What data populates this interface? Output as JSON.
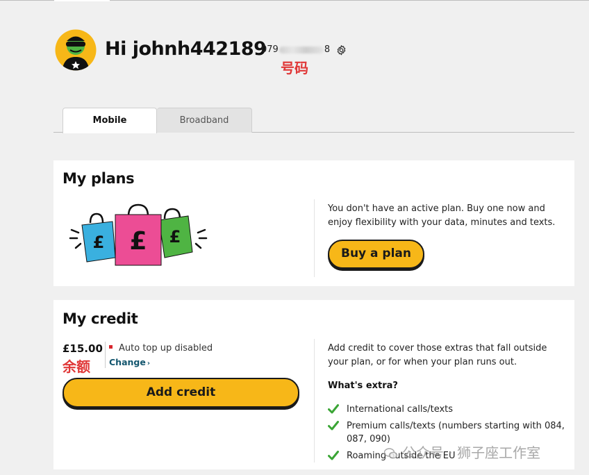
{
  "header": {
    "greeting": "Hi johnh442189",
    "phone_prefix": "079",
    "phone_suffix": "8",
    "phone_annotation": "号码"
  },
  "tabs": [
    {
      "label": "Mobile",
      "active": true
    },
    {
      "label": "Broadband",
      "active": false
    }
  ],
  "plans": {
    "title": "My plans",
    "message": "You don't have an active plan. Buy one now and enjoy flexibility with your data, minutes and texts.",
    "buy_button": "Buy a plan"
  },
  "credit": {
    "title": "My credit",
    "amount": "£15.00",
    "amount_annotation": "余额",
    "auto_topup_status": "Auto top up disabled",
    "change_link": "Change",
    "add_button": "Add credit",
    "message": "Add credit to cover those extras that fall outside your plan, or for when your plan runs out.",
    "extras_heading": "What's extra?",
    "extras": [
      "International calls/texts",
      "Premium calls/texts (numbers starting with 084, 087, 090)",
      "Roaming outside the EU"
    ]
  },
  "watermark": "公众号 · 狮子座工作室",
  "colors": {
    "accent_yellow": "#f7b718",
    "link_teal": "#13566e",
    "status_red": "#d8262d",
    "check_green": "#3aa535",
    "annotation_red": "#e03838",
    "bag_blue": "#3ab0df",
    "bag_pink": "#ec4d95",
    "bag_green": "#4fb443"
  },
  "icons": [
    "avatar-icon",
    "gear-icon",
    "shopping-bags-illustration",
    "check-icon",
    "chevron-right-icon",
    "wechat-icon"
  ]
}
